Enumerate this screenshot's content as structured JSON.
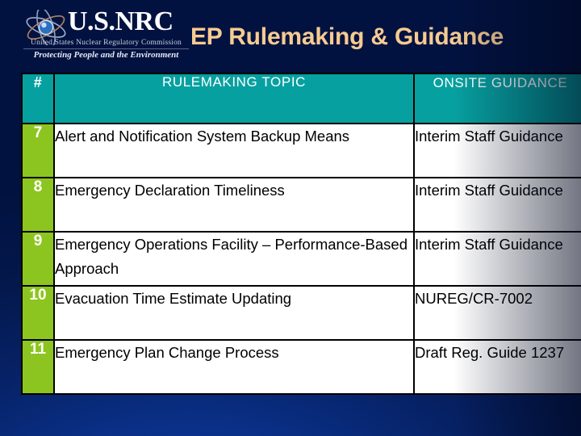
{
  "logo": {
    "icon": "atom-icon",
    "wordmark": "U.S.NRC",
    "agency": "United States Nuclear Regulatory Commission",
    "tagline": "Protecting People and the Environment"
  },
  "title": "EP Rulemaking & Guidance",
  "colors": {
    "background_top": "#021240",
    "background_bottom": "#0B3087",
    "title_text": "#F7CB91",
    "header_fill": "#07A0A0",
    "number_fill": "#8DC520",
    "cell_fill": "#FFFFFF",
    "border": "#000000"
  },
  "table": {
    "headers": {
      "number": "#",
      "topic": "RULEMAKING TOPIC",
      "guidance": "ONSITE GUIDANCE"
    },
    "rows": [
      {
        "number": "7",
        "topic": "Alert and Notification System Backup Means",
        "guidance": "Interim Staff Guidance"
      },
      {
        "number": "8",
        "topic": "Emergency Declaration Timeliness",
        "guidance": "Interim Staff Guidance"
      },
      {
        "number": "9",
        "topic": "Emergency Operations Facility – Performance-Based Approach",
        "guidance": "Interim Staff Guidance"
      },
      {
        "number": "10",
        "topic": "Evacuation Time Estimate Updating",
        "guidance": "NUREG/CR-7002"
      },
      {
        "number": "11",
        "topic": "Emergency Plan Change Process",
        "guidance": "Draft Reg. Guide 1237"
      }
    ]
  }
}
